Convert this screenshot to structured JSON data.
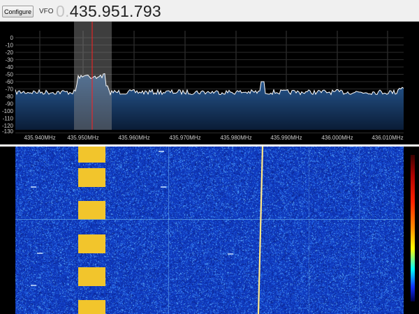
{
  "toolbar": {
    "configure_label": "Configure",
    "vfo_label": "VFO",
    "vfo_prefix": "0.",
    "vfo_frequency": "435.951.793"
  },
  "spectrum": {
    "db_ticks": [
      "0",
      "-10",
      "-20",
      "-30",
      "-40",
      "-50",
      "-60",
      "-70",
      "-80",
      "-90",
      "-100",
      "-110",
      "-120",
      "-130"
    ],
    "freq_ticks": [
      "435.940MHz",
      "435.950MHz",
      "435.960MHz",
      "435.970MHz",
      "435.980MHz",
      "435.990MHz",
      "436.000MHz",
      "436.010MHz"
    ],
    "colors": {
      "trace": "#ffffff",
      "fill_top": "#2a5f9c",
      "fill_bottom": "#0a1c36",
      "vfo_marker": "#ff2020",
      "filter_band": "#7a7a7a"
    }
  },
  "waterfall": {
    "colors": {
      "background": "#1a44c0",
      "signal": "#f2c52c",
      "carrier": "#ffe066"
    }
  }
}
